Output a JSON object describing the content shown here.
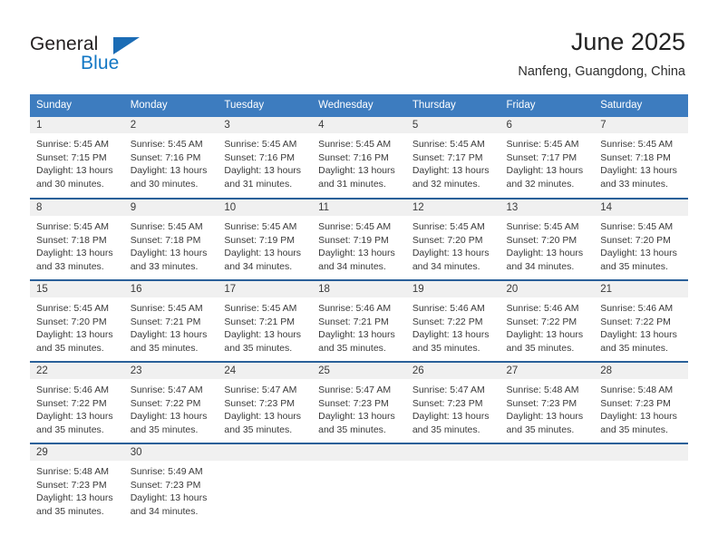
{
  "brand": {
    "name_part1": "General",
    "name_part2": "Blue",
    "logo_icon": "blue-triangle-icon",
    "color_dark": "#231f20",
    "color_blue": "#1277c4"
  },
  "header": {
    "title": "June 2025",
    "subtitle": "Nanfeng, Guangdong, China"
  },
  "theme": {
    "header_blue": "#3d7cbf",
    "row_divider": "#2a6099",
    "daynum_strip": "#f0f0f0",
    "text": "#3a3a3a"
  },
  "calendar": {
    "weekday_headers": [
      "Sunday",
      "Monday",
      "Tuesday",
      "Wednesday",
      "Thursday",
      "Friday",
      "Saturday"
    ],
    "weeks": [
      [
        {
          "day": "1",
          "sunrise": "Sunrise: 5:45 AM",
          "sunset": "Sunset: 7:15 PM",
          "daylight_1": "Daylight: 13 hours",
          "daylight_2": "and 30 minutes."
        },
        {
          "day": "2",
          "sunrise": "Sunrise: 5:45 AM",
          "sunset": "Sunset: 7:16 PM",
          "daylight_1": "Daylight: 13 hours",
          "daylight_2": "and 30 minutes."
        },
        {
          "day": "3",
          "sunrise": "Sunrise: 5:45 AM",
          "sunset": "Sunset: 7:16 PM",
          "daylight_1": "Daylight: 13 hours",
          "daylight_2": "and 31 minutes."
        },
        {
          "day": "4",
          "sunrise": "Sunrise: 5:45 AM",
          "sunset": "Sunset: 7:16 PM",
          "daylight_1": "Daylight: 13 hours",
          "daylight_2": "and 31 minutes."
        },
        {
          "day": "5",
          "sunrise": "Sunrise: 5:45 AM",
          "sunset": "Sunset: 7:17 PM",
          "daylight_1": "Daylight: 13 hours",
          "daylight_2": "and 32 minutes."
        },
        {
          "day": "6",
          "sunrise": "Sunrise: 5:45 AM",
          "sunset": "Sunset: 7:17 PM",
          "daylight_1": "Daylight: 13 hours",
          "daylight_2": "and 32 minutes."
        },
        {
          "day": "7",
          "sunrise": "Sunrise: 5:45 AM",
          "sunset": "Sunset: 7:18 PM",
          "daylight_1": "Daylight: 13 hours",
          "daylight_2": "and 33 minutes."
        }
      ],
      [
        {
          "day": "8",
          "sunrise": "Sunrise: 5:45 AM",
          "sunset": "Sunset: 7:18 PM",
          "daylight_1": "Daylight: 13 hours",
          "daylight_2": "and 33 minutes."
        },
        {
          "day": "9",
          "sunrise": "Sunrise: 5:45 AM",
          "sunset": "Sunset: 7:18 PM",
          "daylight_1": "Daylight: 13 hours",
          "daylight_2": "and 33 minutes."
        },
        {
          "day": "10",
          "sunrise": "Sunrise: 5:45 AM",
          "sunset": "Sunset: 7:19 PM",
          "daylight_1": "Daylight: 13 hours",
          "daylight_2": "and 34 minutes."
        },
        {
          "day": "11",
          "sunrise": "Sunrise: 5:45 AM",
          "sunset": "Sunset: 7:19 PM",
          "daylight_1": "Daylight: 13 hours",
          "daylight_2": "and 34 minutes."
        },
        {
          "day": "12",
          "sunrise": "Sunrise: 5:45 AM",
          "sunset": "Sunset: 7:20 PM",
          "daylight_1": "Daylight: 13 hours",
          "daylight_2": "and 34 minutes."
        },
        {
          "day": "13",
          "sunrise": "Sunrise: 5:45 AM",
          "sunset": "Sunset: 7:20 PM",
          "daylight_1": "Daylight: 13 hours",
          "daylight_2": "and 34 minutes."
        },
        {
          "day": "14",
          "sunrise": "Sunrise: 5:45 AM",
          "sunset": "Sunset: 7:20 PM",
          "daylight_1": "Daylight: 13 hours",
          "daylight_2": "and 35 minutes."
        }
      ],
      [
        {
          "day": "15",
          "sunrise": "Sunrise: 5:45 AM",
          "sunset": "Sunset: 7:20 PM",
          "daylight_1": "Daylight: 13 hours",
          "daylight_2": "and 35 minutes."
        },
        {
          "day": "16",
          "sunrise": "Sunrise: 5:45 AM",
          "sunset": "Sunset: 7:21 PM",
          "daylight_1": "Daylight: 13 hours",
          "daylight_2": "and 35 minutes."
        },
        {
          "day": "17",
          "sunrise": "Sunrise: 5:45 AM",
          "sunset": "Sunset: 7:21 PM",
          "daylight_1": "Daylight: 13 hours",
          "daylight_2": "and 35 minutes."
        },
        {
          "day": "18",
          "sunrise": "Sunrise: 5:46 AM",
          "sunset": "Sunset: 7:21 PM",
          "daylight_1": "Daylight: 13 hours",
          "daylight_2": "and 35 minutes."
        },
        {
          "day": "19",
          "sunrise": "Sunrise: 5:46 AM",
          "sunset": "Sunset: 7:22 PM",
          "daylight_1": "Daylight: 13 hours",
          "daylight_2": "and 35 minutes."
        },
        {
          "day": "20",
          "sunrise": "Sunrise: 5:46 AM",
          "sunset": "Sunset: 7:22 PM",
          "daylight_1": "Daylight: 13 hours",
          "daylight_2": "and 35 minutes."
        },
        {
          "day": "21",
          "sunrise": "Sunrise: 5:46 AM",
          "sunset": "Sunset: 7:22 PM",
          "daylight_1": "Daylight: 13 hours",
          "daylight_2": "and 35 minutes."
        }
      ],
      [
        {
          "day": "22",
          "sunrise": "Sunrise: 5:46 AM",
          "sunset": "Sunset: 7:22 PM",
          "daylight_1": "Daylight: 13 hours",
          "daylight_2": "and 35 minutes."
        },
        {
          "day": "23",
          "sunrise": "Sunrise: 5:47 AM",
          "sunset": "Sunset: 7:22 PM",
          "daylight_1": "Daylight: 13 hours",
          "daylight_2": "and 35 minutes."
        },
        {
          "day": "24",
          "sunrise": "Sunrise: 5:47 AM",
          "sunset": "Sunset: 7:23 PM",
          "daylight_1": "Daylight: 13 hours",
          "daylight_2": "and 35 minutes."
        },
        {
          "day": "25",
          "sunrise": "Sunrise: 5:47 AM",
          "sunset": "Sunset: 7:23 PM",
          "daylight_1": "Daylight: 13 hours",
          "daylight_2": "and 35 minutes."
        },
        {
          "day": "26",
          "sunrise": "Sunrise: 5:47 AM",
          "sunset": "Sunset: 7:23 PM",
          "daylight_1": "Daylight: 13 hours",
          "daylight_2": "and 35 minutes."
        },
        {
          "day": "27",
          "sunrise": "Sunrise: 5:48 AM",
          "sunset": "Sunset: 7:23 PM",
          "daylight_1": "Daylight: 13 hours",
          "daylight_2": "and 35 minutes."
        },
        {
          "day": "28",
          "sunrise": "Sunrise: 5:48 AM",
          "sunset": "Sunset: 7:23 PM",
          "daylight_1": "Daylight: 13 hours",
          "daylight_2": "and 35 minutes."
        }
      ],
      [
        {
          "day": "29",
          "sunrise": "Sunrise: 5:48 AM",
          "sunset": "Sunset: 7:23 PM",
          "daylight_1": "Daylight: 13 hours",
          "daylight_2": "and 35 minutes."
        },
        {
          "day": "30",
          "sunrise": "Sunrise: 5:49 AM",
          "sunset": "Sunset: 7:23 PM",
          "daylight_1": "Daylight: 13 hours",
          "daylight_2": "and 34 minutes."
        },
        {
          "day": "",
          "sunrise": "",
          "sunset": "",
          "daylight_1": "",
          "daylight_2": ""
        },
        {
          "day": "",
          "sunrise": "",
          "sunset": "",
          "daylight_1": "",
          "daylight_2": ""
        },
        {
          "day": "",
          "sunrise": "",
          "sunset": "",
          "daylight_1": "",
          "daylight_2": ""
        },
        {
          "day": "",
          "sunrise": "",
          "sunset": "",
          "daylight_1": "",
          "daylight_2": ""
        },
        {
          "day": "",
          "sunrise": "",
          "sunset": "",
          "daylight_1": "",
          "daylight_2": ""
        }
      ]
    ]
  }
}
